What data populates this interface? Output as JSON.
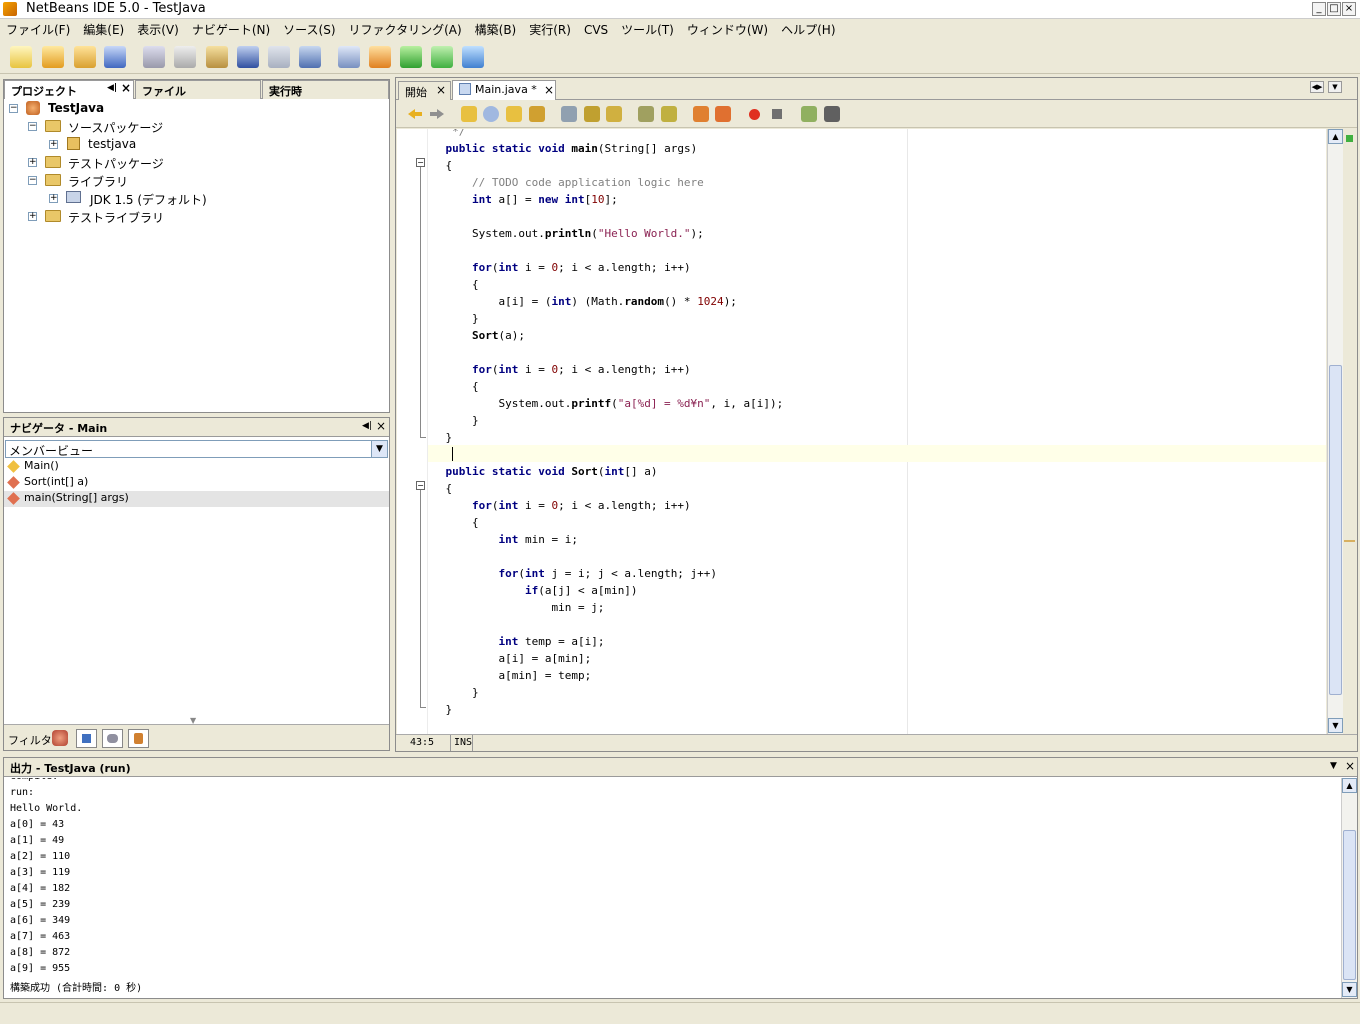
{
  "window": {
    "title": "NetBeans IDE 5.0 - TestJava",
    "controls": [
      "_",
      "□",
      "×"
    ]
  },
  "menu": [
    "ファイル(F)",
    "編集(E)",
    "表示(V)",
    "ナビゲート(N)",
    "ソース(S)",
    "リファクタリング(A)",
    "構築(B)",
    "実行(R)",
    "CVS",
    "ツール(T)",
    "ウィンドウ(W)",
    "ヘルプ(H)"
  ],
  "toolbar_icons": [
    "new-file-icon",
    "new-project-icon",
    "open-project-icon",
    "save-all-icon",
    "cut-icon",
    "copy-icon",
    "paste-icon",
    "undo-icon",
    "redo-icon",
    "find-icon",
    "build-icon",
    "clean-build-icon",
    "run-icon",
    "debug-icon",
    "profile-icon"
  ],
  "project_panel": {
    "tabs": [
      "プロジェクト",
      "ファイル",
      "実行時"
    ],
    "tree": [
      {
        "label": "TestJava",
        "bold": true
      },
      {
        "label": "ソースパッケージ"
      },
      {
        "label": "testjava"
      },
      {
        "label": "テストパッケージ"
      },
      {
        "label": "ライブラリ"
      },
      {
        "label": "JDK 1.5 (デフォルト)"
      },
      {
        "label": "テストライブラリ"
      }
    ]
  },
  "navigator": {
    "title": "ナビゲータ - Main",
    "view": "メンバービュー",
    "items": [
      "Main()",
      "Sort(int[] a)",
      "main(String[] args)"
    ],
    "filter_label": "フィルタ:"
  },
  "editor": {
    "tabs": [
      "開始",
      "Main.java *"
    ],
    "status": {
      "position": "43:5",
      "mode": "INS"
    }
  },
  "code": [
    "     */",
    "    public static void main(String[] args)",
    "    {",
    "        // TODO code application logic here",
    "        int a[] = new int[10];",
    "",
    "        System.out.println(\"Hello World.\");",
    "",
    "        for(int i = 0; i < a.length; i++)",
    "        {",
    "            a[i] = (int) (Math.random() * 1024);",
    "        }",
    "        Sort(a);",
    "",
    "        for(int i = 0; i < a.length; i++)",
    "        {",
    "            System.out.printf(\"a[%d] = %d¥n\", i, a[i]);",
    "        }",
    "    }",
    "",
    "    public static void Sort(int[] a)",
    "    {",
    "        for(int i = 0; i < a.length; i++)",
    "        {",
    "            int min = i;",
    "",
    "            for(int j = i; j < a.length; j++)",
    "                if(a[j] < a[min])",
    "                    min = j;",
    "",
    "            int temp = a[i];",
    "            a[i] = a[min];",
    "            a[min] = temp;",
    "        }",
    "    }"
  ],
  "output": {
    "title": "出力 - TestJava (run)",
    "lines": [
      "compile:",
      "run:",
      "Hello World.",
      "a[0] = 43",
      "a[1] = 49",
      "a[2] = 110",
      "a[3] = 119",
      "a[4] = 182",
      "a[5] = 239",
      "a[6] = 349",
      "a[7] = 463",
      "a[8] = 872",
      "a[9] = 955",
      "構築成功 (合計時間: 0 秒)"
    ]
  }
}
